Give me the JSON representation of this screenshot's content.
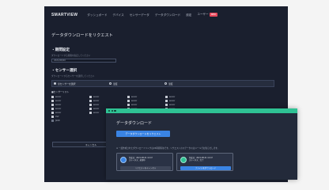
{
  "app": {
    "logo": "SMARTVIEW",
    "nav": [
      "ダッシュボード",
      "デバイス",
      "センサーデータ",
      "データダウンロード",
      "設定",
      "ユーザー"
    ],
    "nav_badge": "NEW"
  },
  "page": {
    "title": "データダウンロードをリクエスト",
    "period_heading": "・期間設定",
    "period_hint": "ダウンロードする期間を指定してください",
    "date_value": "2021/08/20",
    "sensor_heading": "・センサー選択",
    "sensor_hint": "ダウンロードするセンサーを選択してください",
    "radio_options": [
      "全センサーを選択",
      "温度",
      "湿度"
    ],
    "group_label": "■センサーリスト",
    "checkboxes": [
      "sensor",
      "sensor",
      "sensor",
      "sensor",
      "sensor",
      "sensor",
      "sensor",
      "sensor",
      "sensor",
      "sensor",
      "sensor",
      "sensor",
      "sensor",
      "sensor",
      "sensor",
      "sensor",
      "sensor",
      "sensor",
      "sensor",
      "sensor"
    ],
    "format_options": [
      "CSV",
      "JSON"
    ],
    "cancel_label": "キャンセル"
  },
  "dialog": {
    "title": "データダウンロード",
    "download_button": "データダウンロードをリクエスト",
    "note": "※ 一度作成されたダウンロードリンクは24時間有効です。リクエストのステータスはメールでお知らせします。",
    "cards": [
      {
        "line1": "作成日：2021-08-21 12:47",
        "line2": "ステータス：処理中",
        "button": "リクエストをキャンセル",
        "icon_color": "#3a84e4",
        "button_bg": "#3d4558",
        "button_fg": "#c7ccd6"
      },
      {
        "line1": "作成日：2021-08-21 12:47",
        "line2": "ステータス：完了",
        "button": "ファイルをダウンロード",
        "icon_color": "#2fc294",
        "button_bg": "#3a84e4",
        "button_fg": "#f5f7fb"
      }
    ]
  },
  "colors": {
    "accent": "#2fc294",
    "primary": "#3a84e4",
    "badge": "#e8485c",
    "bg": "#1a1f2e"
  }
}
